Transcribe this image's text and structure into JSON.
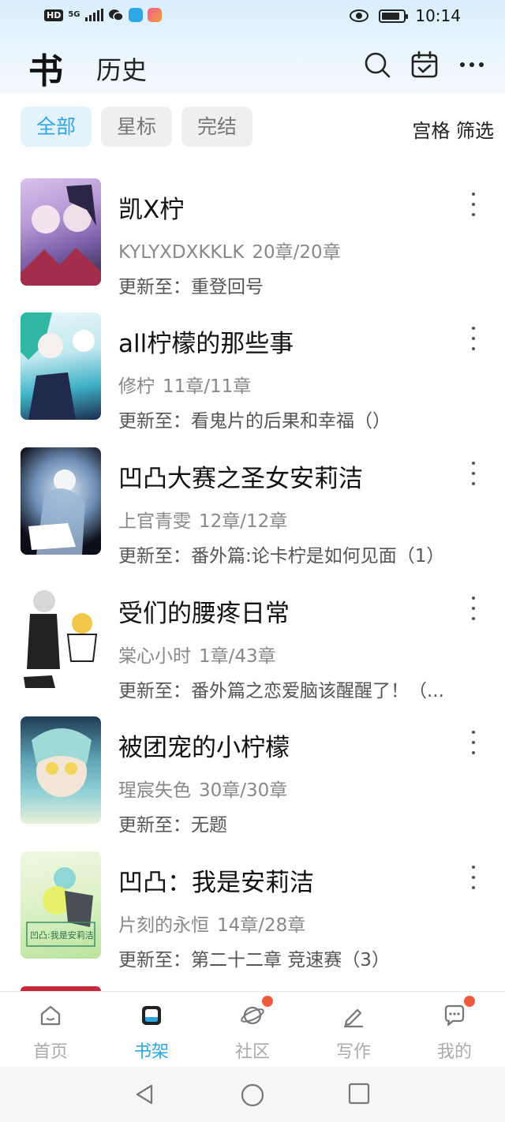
{
  "status_bar": {
    "hd": "HD",
    "signal": "5G",
    "time": "10:14",
    "wechat_icon": "wechat-icon",
    "eye_icon": "eye-icon"
  },
  "header": {
    "title": "书",
    "history_tab": "历史"
  },
  "filters": {
    "chips": [
      "全部",
      "星标",
      "完结"
    ],
    "grid_filter": "宫格 筛选"
  },
  "books": [
    {
      "title": "凯X柠",
      "author": "KYLYXDXKKLK",
      "chapters": "20章/20章",
      "update": "更新至：重登回号",
      "cover_colors": [
        "#d9c2ec",
        "#7b5fa8",
        "#2a2440"
      ]
    },
    {
      "title": "all柠檬的那些事",
      "author": "修柠",
      "chapters": "11章/11章",
      "update": "更新至：看鬼片的后果和幸福（）",
      "cover_colors": [
        "#bfe8ef",
        "#3eb0c6",
        "#1d2d4f"
      ]
    },
    {
      "title": "凹凸大赛之圣女安莉洁",
      "author": "上官青雯",
      "chapters": "12章/12章",
      "update": "更新至：番外篇:论卡柠是如何见面（1）",
      "cover_colors": [
        "#0d0f18",
        "#6e8fb6",
        "#dfe8f3"
      ]
    },
    {
      "title": "受们的腰疼日常",
      "author": "棠心小时",
      "chapters": "1章/43章",
      "update": "更新至：番外篇之恋爱脑该醒醒了！（...",
      "cover_colors": [
        "#ffffff",
        "#222222",
        "#f1c84a"
      ]
    },
    {
      "title": "被团宠的小柠檬",
      "author": "瑆宸失色",
      "chapters": "30章/30章",
      "update": "更新至：无题",
      "cover_colors": [
        "#1e3c55",
        "#8fd1d6",
        "#f1e7b8"
      ]
    },
    {
      "title": "凹凸：我是安莉洁",
      "author": "片刻的永恒",
      "chapters": "14章/28章",
      "update": "更新至：第二十二章 竞速赛（3）",
      "cover_colors": [
        "#dff2c8",
        "#9ad97a",
        "#4f6e48"
      ]
    }
  ],
  "tabs": [
    {
      "label": "首页",
      "icon": "home-icon",
      "badge": false
    },
    {
      "label": "书架",
      "icon": "bookshelf-icon",
      "badge": false
    },
    {
      "label": "社区",
      "icon": "planet-icon",
      "badge": true
    },
    {
      "label": "写作",
      "icon": "pen-icon",
      "badge": false
    },
    {
      "label": "我的",
      "icon": "chat-icon",
      "badge": true
    }
  ],
  "accent_color": "#2ea7e6",
  "badge_color": "#ee5a3c"
}
